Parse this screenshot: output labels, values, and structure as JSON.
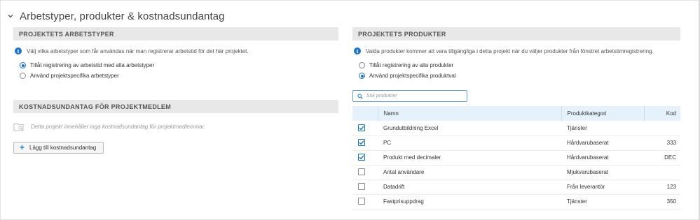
{
  "section": {
    "title": "Arbetstyper, produkter & kostnadsundantag"
  },
  "work_types": {
    "heading": "PROJEKTETS ARBETSTYPER",
    "info": "Välj vilka arbetstyper som får användas när man registrerar arbetstid för det här projektet.",
    "options": [
      {
        "label": "Tillåt registrering av arbetstid med alla arbetstyper",
        "selected": true
      },
      {
        "label": "Använd projektspecifika arbetstyper",
        "selected": false
      }
    ]
  },
  "cost_exceptions": {
    "heading": "KOSTNADSUNDANTAG FÖR PROJEKTMEDLEM",
    "empty_text": "Detta projekt innehåller inga kostnadsundantag för projektmedlemmar.",
    "add_button": "Lägg till kostnadsundantag"
  },
  "products": {
    "heading": "PROJEKTETS PRODUKTER",
    "info": "Valda produkter kommer att vara tillgängliga i detta projekt när du väljer produkter från fönstret arbetstimregistrering.",
    "options": [
      {
        "label": "Tillåt registrering av alla produkter",
        "selected": false
      },
      {
        "label": "Använd projektspecifika produktval",
        "selected": true
      }
    ],
    "search": {
      "placeholder": "Sök produkter",
      "value": ""
    },
    "table": {
      "columns": [
        "Namn",
        "Produktkategori",
        "Kod"
      ],
      "rows": [
        {
          "checked": true,
          "name": "Grundutbildning Excel",
          "category": "Tjänster",
          "code": ""
        },
        {
          "checked": true,
          "name": "PC",
          "category": "Hårdvarubaserat",
          "code": "333"
        },
        {
          "checked": true,
          "name": "Produkt med decimaler",
          "category": "Hårdvarubaserat",
          "code": "DEC"
        },
        {
          "checked": false,
          "name": "Antal användare",
          "category": "Mjukvarubaserat",
          "code": ""
        },
        {
          "checked": false,
          "name": "Datadrift",
          "category": "Från leverantör",
          "code": "123"
        },
        {
          "checked": false,
          "name": "Fastprisuppdrag",
          "category": "Tjänster",
          "code": "350"
        }
      ]
    }
  },
  "colors": {
    "accent": "#1a73c9",
    "panel_header_bg": "#e8e8e8",
    "table_header_bg": "#e6f2fb"
  },
  "icons": [
    "chevron-down-icon",
    "info-icon",
    "folder-search-icon",
    "plus-icon",
    "search-icon",
    "checkmark-icon"
  ]
}
